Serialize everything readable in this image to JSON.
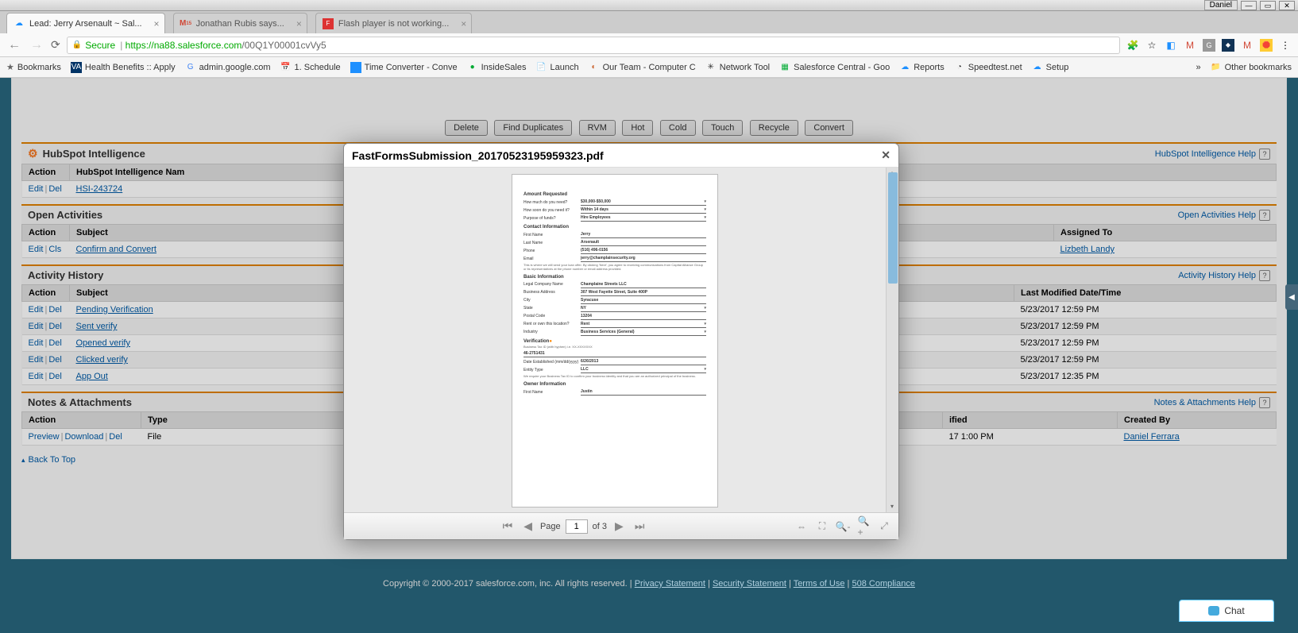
{
  "window": {
    "user_label": "Daniel"
  },
  "tabs": [
    {
      "title": "Lead: Jerry Arsenault ~ Sal...",
      "icon": "salesforce",
      "active": true
    },
    {
      "title": "Jonathan Rubis says...",
      "icon": "gmail",
      "badge": "15",
      "active": false
    },
    {
      "title": "Flash player is not working...",
      "icon": "flash",
      "active": false
    }
  ],
  "urlbar": {
    "secure_label": "Secure",
    "host": "https://na88.salesforce.com",
    "path": "/00Q1Y00001cvVy5"
  },
  "bookmarks": {
    "label": "Bookmarks",
    "items": [
      "Health Benefits :: Apply",
      "admin.google.com",
      "1. Schedule",
      "Time Converter - Conve",
      "InsideSales",
      "Launch",
      "Our Team - Computer C",
      "Network Tool",
      "Salesforce Central - Goo",
      "Reports",
      "Speedtest.net",
      "Setup"
    ],
    "other": "Other bookmarks"
  },
  "action_bar": [
    "Delete",
    "Find Duplicates",
    "RVM",
    "Hot",
    "Cold",
    "Touch",
    "Recycle",
    "Convert"
  ],
  "sections": {
    "hubspot": {
      "title": "HubSpot Intelligence",
      "help": "HubSpot Intelligence Help",
      "cols": [
        "Action",
        "HubSpot Intelligence Nam"
      ],
      "rows": [
        {
          "actions": [
            "Edit",
            "Del"
          ],
          "name": "HSI-243724"
        }
      ]
    },
    "open_activities": {
      "title": "Open Activities",
      "help": "Open Activities Help",
      "cols": [
        "Action",
        "Subject",
        "Assigned To"
      ],
      "rows": [
        {
          "actions": [
            "Edit",
            "Cls"
          ],
          "subject": "Confirm and Convert",
          "assigned": "Lizbeth Landy"
        }
      ]
    },
    "activity_history": {
      "title": "Activity History",
      "help": "Activity History Help",
      "cols": [
        "Action",
        "Subject",
        "Last Modified Date/Time"
      ],
      "rows": [
        {
          "actions": [
            "Edit",
            "Del"
          ],
          "subject": "Pending Verification",
          "modified": "5/23/2017 12:59 PM"
        },
        {
          "actions": [
            "Edit",
            "Del"
          ],
          "subject": "Sent verify",
          "modified": "5/23/2017 12:59 PM"
        },
        {
          "actions": [
            "Edit",
            "Del"
          ],
          "subject": "Opened verify",
          "modified": "5/23/2017 12:59 PM"
        },
        {
          "actions": [
            "Edit",
            "Del"
          ],
          "subject": "Clicked verify",
          "modified": "5/23/2017 12:59 PM"
        },
        {
          "actions": [
            "Edit",
            "Del"
          ],
          "subject": "App Out",
          "modified": "5/23/2017 12:35 PM"
        }
      ]
    },
    "notes": {
      "title": "Notes & Attachments",
      "help": "Notes & Attachments Help",
      "cols": [
        "Action",
        "Type",
        "ified",
        "Created By"
      ],
      "rows": [
        {
          "actions": [
            "Preview",
            "Download",
            "Del"
          ],
          "type": "File",
          "modified": "17 1:00 PM",
          "created_by": "Daniel Ferrara"
        }
      ]
    }
  },
  "back_to_top": "Back To Top",
  "footer": {
    "copyright": "Copyright © 2000-2017 salesforce.com, inc. All rights reserved.",
    "links": [
      "Privacy Statement",
      "Security Statement",
      "Terms of Use",
      "508 Compliance"
    ]
  },
  "chat": {
    "label": "Chat"
  },
  "modal": {
    "title": "FastFormsSubmission_20170523195959323.pdf",
    "page_label": "Page",
    "current_page": "1",
    "of_label": "of 3",
    "pdf": {
      "s1_title": "Amount Requested",
      "s1_rows": [
        {
          "label": "How much do you need?",
          "value": "$30,000-$50,000",
          "sel": true
        },
        {
          "label": "How soon do you need it?",
          "value": "Within 14 days",
          "sel": true
        },
        {
          "label": "Purpose of funds?",
          "value": "Hire Employees",
          "sel": true
        }
      ],
      "s2_title": "Contact Information",
      "s2_rows": [
        {
          "label": "First Name",
          "value": "Jerry"
        },
        {
          "label": "Last Name",
          "value": "Arsenault"
        },
        {
          "label": "Phone",
          "value": "(516) 496-0156"
        },
        {
          "label": "Email",
          "value": "jerry@champlainsecurity.org"
        }
      ],
      "s2_note": "This is where we will send your loan offer. By clicking 'Next', you agree to receiving communications from Capital Alliance Group or its representatives at the phone number or email address provided.",
      "s3_title": "Basic Information",
      "s3_rows": [
        {
          "label": "Legal Company Name",
          "value": "Champlaine Streets LLC"
        },
        {
          "label": "Business Address",
          "value": "307 West Fayette Street, Suite 400P"
        },
        {
          "label": "City",
          "value": "Syracuse"
        },
        {
          "label": "State",
          "value": "NY",
          "sel": true
        },
        {
          "label": "Postal Code",
          "value": "13204"
        },
        {
          "label": "Rent or own this location?",
          "value": "Rent",
          "sel": true
        },
        {
          "label": "Industry",
          "value": "Business Services (General)",
          "sel": true
        }
      ],
      "s4_title": "Verification",
      "s4_note1": "Business Tax ID (with hyphen) i.e. XX-XXXXXXX",
      "s4_value": "46-2751431",
      "s4_rows": [
        {
          "label": "Date Established (mm/dd/yyyy)",
          "value": "6/26/2013"
        },
        {
          "label": "Entity Type",
          "value": "LLC",
          "sel": true
        }
      ],
      "s4_note2": "We require your Business Tax ID to confirm your business identity and that you are an authorized principal of the business.",
      "s5_title": "Owner Information",
      "s5_rows": [
        {
          "label": "First Name",
          "value": "Justin"
        }
      ]
    }
  }
}
